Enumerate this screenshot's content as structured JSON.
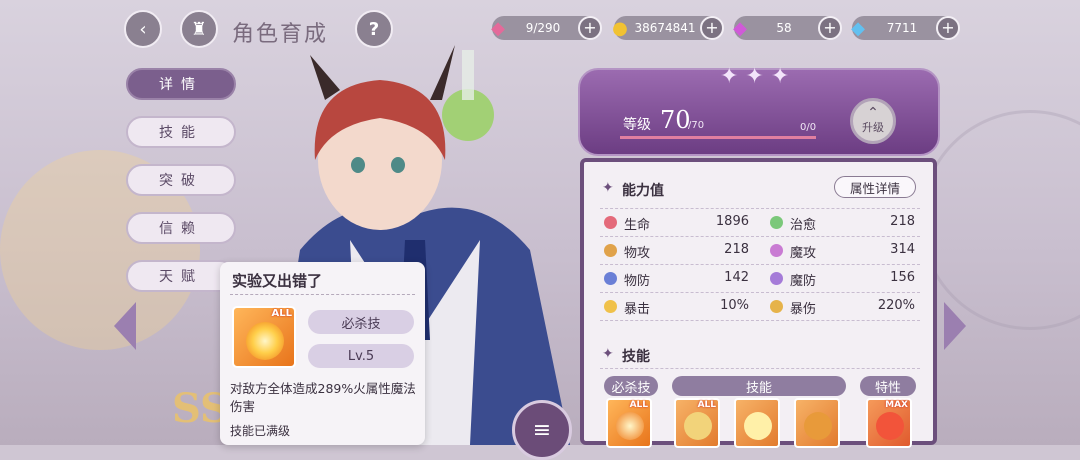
{
  "header": {
    "title": "角色育成"
  },
  "resources": [
    {
      "icon": "candy-icon",
      "value": "9/290"
    },
    {
      "icon": "gold-coin-icon",
      "value": "38674841"
    },
    {
      "icon": "purple-gem-icon",
      "value": "58"
    },
    {
      "icon": "blue-diamond-icon",
      "value": "7711"
    }
  ],
  "sidebar": {
    "items": [
      {
        "label": "详情",
        "active": true
      },
      {
        "label": "技能",
        "active": false
      },
      {
        "label": "突破",
        "active": false
      },
      {
        "label": "信赖",
        "active": false
      },
      {
        "label": "天赋",
        "active": false
      }
    ]
  },
  "level": {
    "label": "等级",
    "value": "70",
    "max": "/70",
    "exp": "0/0",
    "upgrade_label": "升级"
  },
  "stats": {
    "title": "能力值",
    "detail_button": "属性详情",
    "items": [
      {
        "name": "生命",
        "value": "1896",
        "color": "#e46a7a"
      },
      {
        "name": "治愈",
        "value": "218",
        "color": "#7bc87a"
      },
      {
        "name": "物攻",
        "value": "218",
        "color": "#e0a24a"
      },
      {
        "name": "魔攻",
        "value": "314",
        "color": "#c97bd3"
      },
      {
        "name": "物防",
        "value": "142",
        "color": "#6a7fd6"
      },
      {
        "name": "魔防",
        "value": "156",
        "color": "#a57bd8"
      },
      {
        "name": "暴击",
        "value": "10%",
        "color": "#f0c14a"
      },
      {
        "name": "暴伤",
        "value": "220%",
        "color": "#e6b34a"
      }
    ]
  },
  "skills": {
    "title": "技能",
    "tabs": {
      "ultimate": "必杀技",
      "skill": "技能",
      "trait": "特性"
    },
    "icon_tags": {
      "all": "ALL",
      "max": "MAX"
    }
  },
  "popup": {
    "title": "实验又出错了",
    "tag": "ALL",
    "type": "必杀技",
    "level": "Lv.5",
    "description": "对敌方全体造成289%火属性魔法伤害",
    "footer": "技能已满级"
  },
  "background": {
    "rank": "SSR"
  }
}
